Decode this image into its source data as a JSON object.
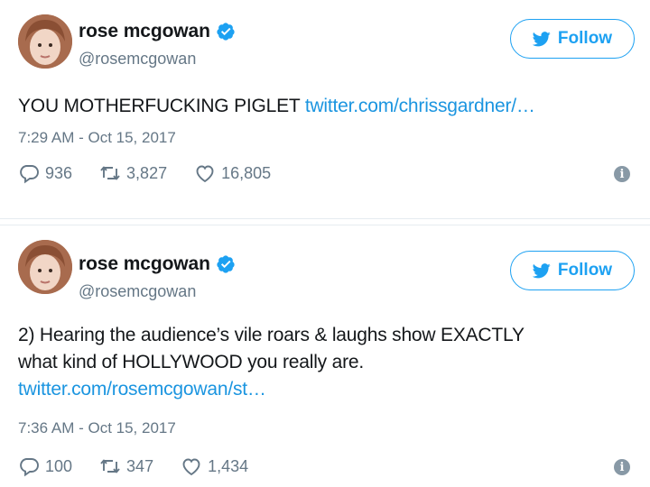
{
  "colors": {
    "brand": "#1da1f2",
    "link": "#1b95e0",
    "muted": "#657786",
    "text": "#14171a"
  },
  "tweets": [
    {
      "author_name": "rose mcgowan",
      "handle": "@rosemcgowan",
      "verified_icon": "verified-badge-icon",
      "follow_label": "Follow",
      "text": "YOU MOTHERFUCKING PIGLET ",
      "link": "twitter.com/chrissgardner/…",
      "timestamp": "7:29 AM - Oct 15, 2017",
      "replies": "936",
      "retweets": "3,827",
      "likes": "16,805"
    },
    {
      "author_name": "rose mcgowan",
      "handle": "@rosemcgowan",
      "verified_icon": "verified-badge-icon",
      "follow_label": "Follow",
      "text_line1": "2) Hearing the audience’s vile roars & laughs show EXACTLY",
      "text_line2": "what kind of HOLLYWOOD you really are.",
      "link": "twitter.com/rosemcgowan/st…",
      "timestamp": "7:36 AM - Oct 15, 2017",
      "replies": "100",
      "retweets": "347",
      "likes": "1,434"
    }
  ]
}
